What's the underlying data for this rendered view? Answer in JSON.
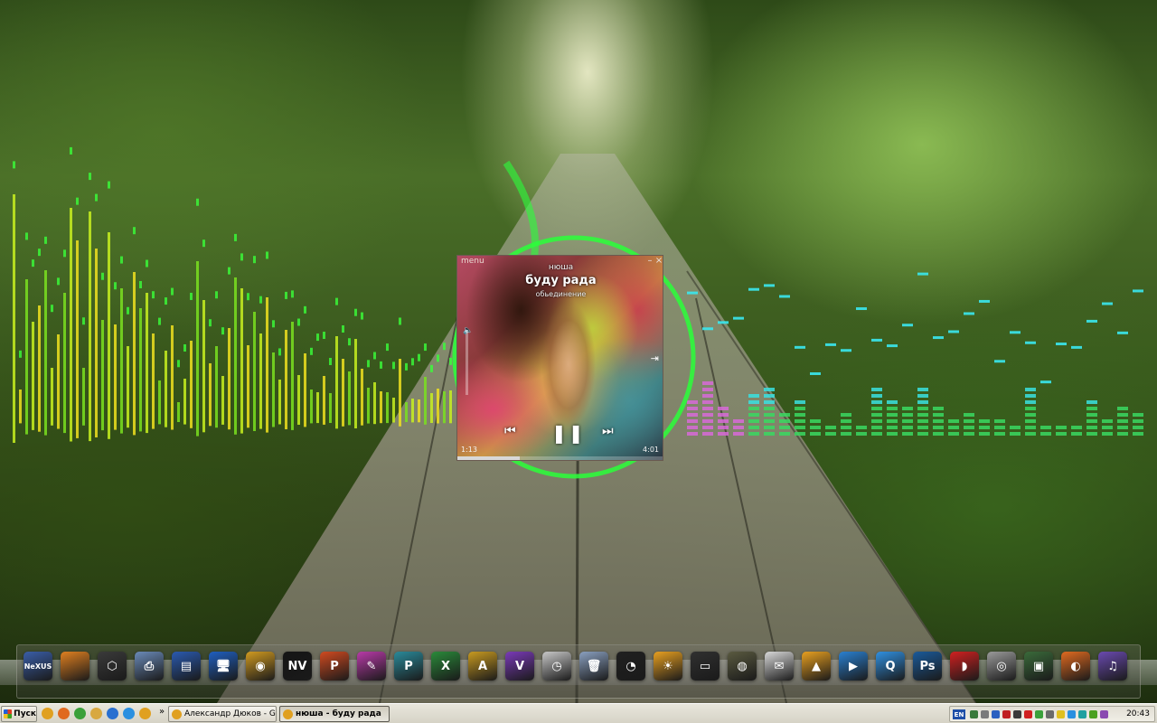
{
  "player": {
    "menu_label": "menu",
    "artist": "нюша",
    "track": "буду рада",
    "album": "обьединение",
    "elapsed": "1:13",
    "total": "4:01",
    "progress": 0.3,
    "minimize_glyph": "–",
    "close_glyph": "×",
    "prev_glyph": "⏮",
    "pause_glyph": "❚❚",
    "next_glyph": "⏭",
    "volume_glyph": "🔈",
    "exit_glyph": "⇥"
  },
  "dock": {
    "items": [
      {
        "name": "nexus-icon",
        "label": "NeXUS",
        "color": "#3a5ea8"
      },
      {
        "name": "sunset-app-icon",
        "label": "",
        "color": "#e08020"
      },
      {
        "name": "hex-tool-icon",
        "label": "⬡",
        "color": "#3a3a3a"
      },
      {
        "name": "scanner-icon",
        "label": "⎙",
        "color": "#6a8ab8"
      },
      {
        "name": "books-icon",
        "label": "▤",
        "color": "#2a5ab0"
      },
      {
        "name": "my-computer-icon",
        "label": "🖥",
        "color": "#1f5fc0"
      },
      {
        "name": "camera-app-icon",
        "label": "◉",
        "color": "#d09a20"
      },
      {
        "name": "nvidia-icon",
        "label": "NV",
        "color": "#151515"
      },
      {
        "name": "powerpoint-icon",
        "label": "P",
        "color": "#d04a20"
      },
      {
        "name": "onenote-icon",
        "label": "✎",
        "color": "#b83aa8"
      },
      {
        "name": "publisher-icon",
        "label": "P",
        "color": "#2a8a9a"
      },
      {
        "name": "excel-icon",
        "label": "X",
        "color": "#2a8a3a"
      },
      {
        "name": "access-icon",
        "label": "A",
        "color": "#c89a20"
      },
      {
        "name": "visio-icon",
        "label": "V",
        "color": "#7a3ab8"
      },
      {
        "name": "clock-widget-icon",
        "label": "◷",
        "color": "#c8c8c8"
      },
      {
        "name": "recycle-bin-icon",
        "label": "🗑",
        "color": "#8aa0c0"
      },
      {
        "name": "cpu-gauge-icon",
        "label": "◔",
        "color": "#202020"
      },
      {
        "name": "weather-icon",
        "label": "☀",
        "color": "#e8a020"
      },
      {
        "name": "drive-meter-icon",
        "label": "▭",
        "color": "#303030"
      },
      {
        "name": "globe-icon",
        "label": "◍",
        "color": "#5a5a40"
      },
      {
        "name": "mail-icon",
        "label": "✉",
        "color": "#d8d8d8"
      },
      {
        "name": "aimp-icon",
        "label": "▲",
        "color": "#e8a020"
      },
      {
        "name": "media-player-icon",
        "label": "▶",
        "color": "#2a80d0"
      },
      {
        "name": "quicktime-icon",
        "label": "Q",
        "color": "#3090e0"
      },
      {
        "name": "photoshop-icon",
        "label": "Ps",
        "color": "#1a5a9a"
      },
      {
        "name": "cyberlink-icon",
        "label": "◗",
        "color": "#d02020"
      },
      {
        "name": "webcam-icon",
        "label": "◎",
        "color": "#9a9a9a"
      },
      {
        "name": "photo-camera-icon",
        "label": "▣",
        "color": "#3a6a3a"
      },
      {
        "name": "firefox-icon",
        "label": "◐",
        "color": "#e06a20"
      },
      {
        "name": "itunes-icon",
        "label": "♫",
        "color": "#6a4ab0"
      }
    ]
  },
  "taskbar": {
    "start_label": "Пуск",
    "quick_launch": [
      {
        "name": "chrome-icon",
        "color": "#e0a020"
      },
      {
        "name": "firefox-icon",
        "color": "#e06a20"
      },
      {
        "name": "utorrent-icon",
        "color": "#3aa03a"
      },
      {
        "name": "show-desktop-icon",
        "color": "#d8a840"
      },
      {
        "name": "ie-icon",
        "color": "#2a70d0"
      },
      {
        "name": "skype-icon",
        "color": "#2a90e0"
      },
      {
        "name": "aimp-icon",
        "color": "#e0a020"
      }
    ],
    "overflow_glyph": "»",
    "tasks": [
      {
        "name": "task-chrome",
        "label": "Александр Дюков - Go...",
        "color": "#e0a020",
        "active": false
      },
      {
        "name": "task-aimp",
        "label": "нюша - буду рада",
        "color": "#e0a020",
        "active": true
      }
    ],
    "tray": {
      "lang": "EN",
      "icons": [
        "#3a7a3a",
        "#7a7a7a",
        "#2a60c0",
        "#c02020",
        "#3a3a3a",
        "#d02020",
        "#3aa03a",
        "#6a6a6a",
        "#e0c020",
        "#2a90e0",
        "#20a0a0",
        "#4aa020",
        "#8a4ab0"
      ],
      "clock": "20:43"
    }
  }
}
